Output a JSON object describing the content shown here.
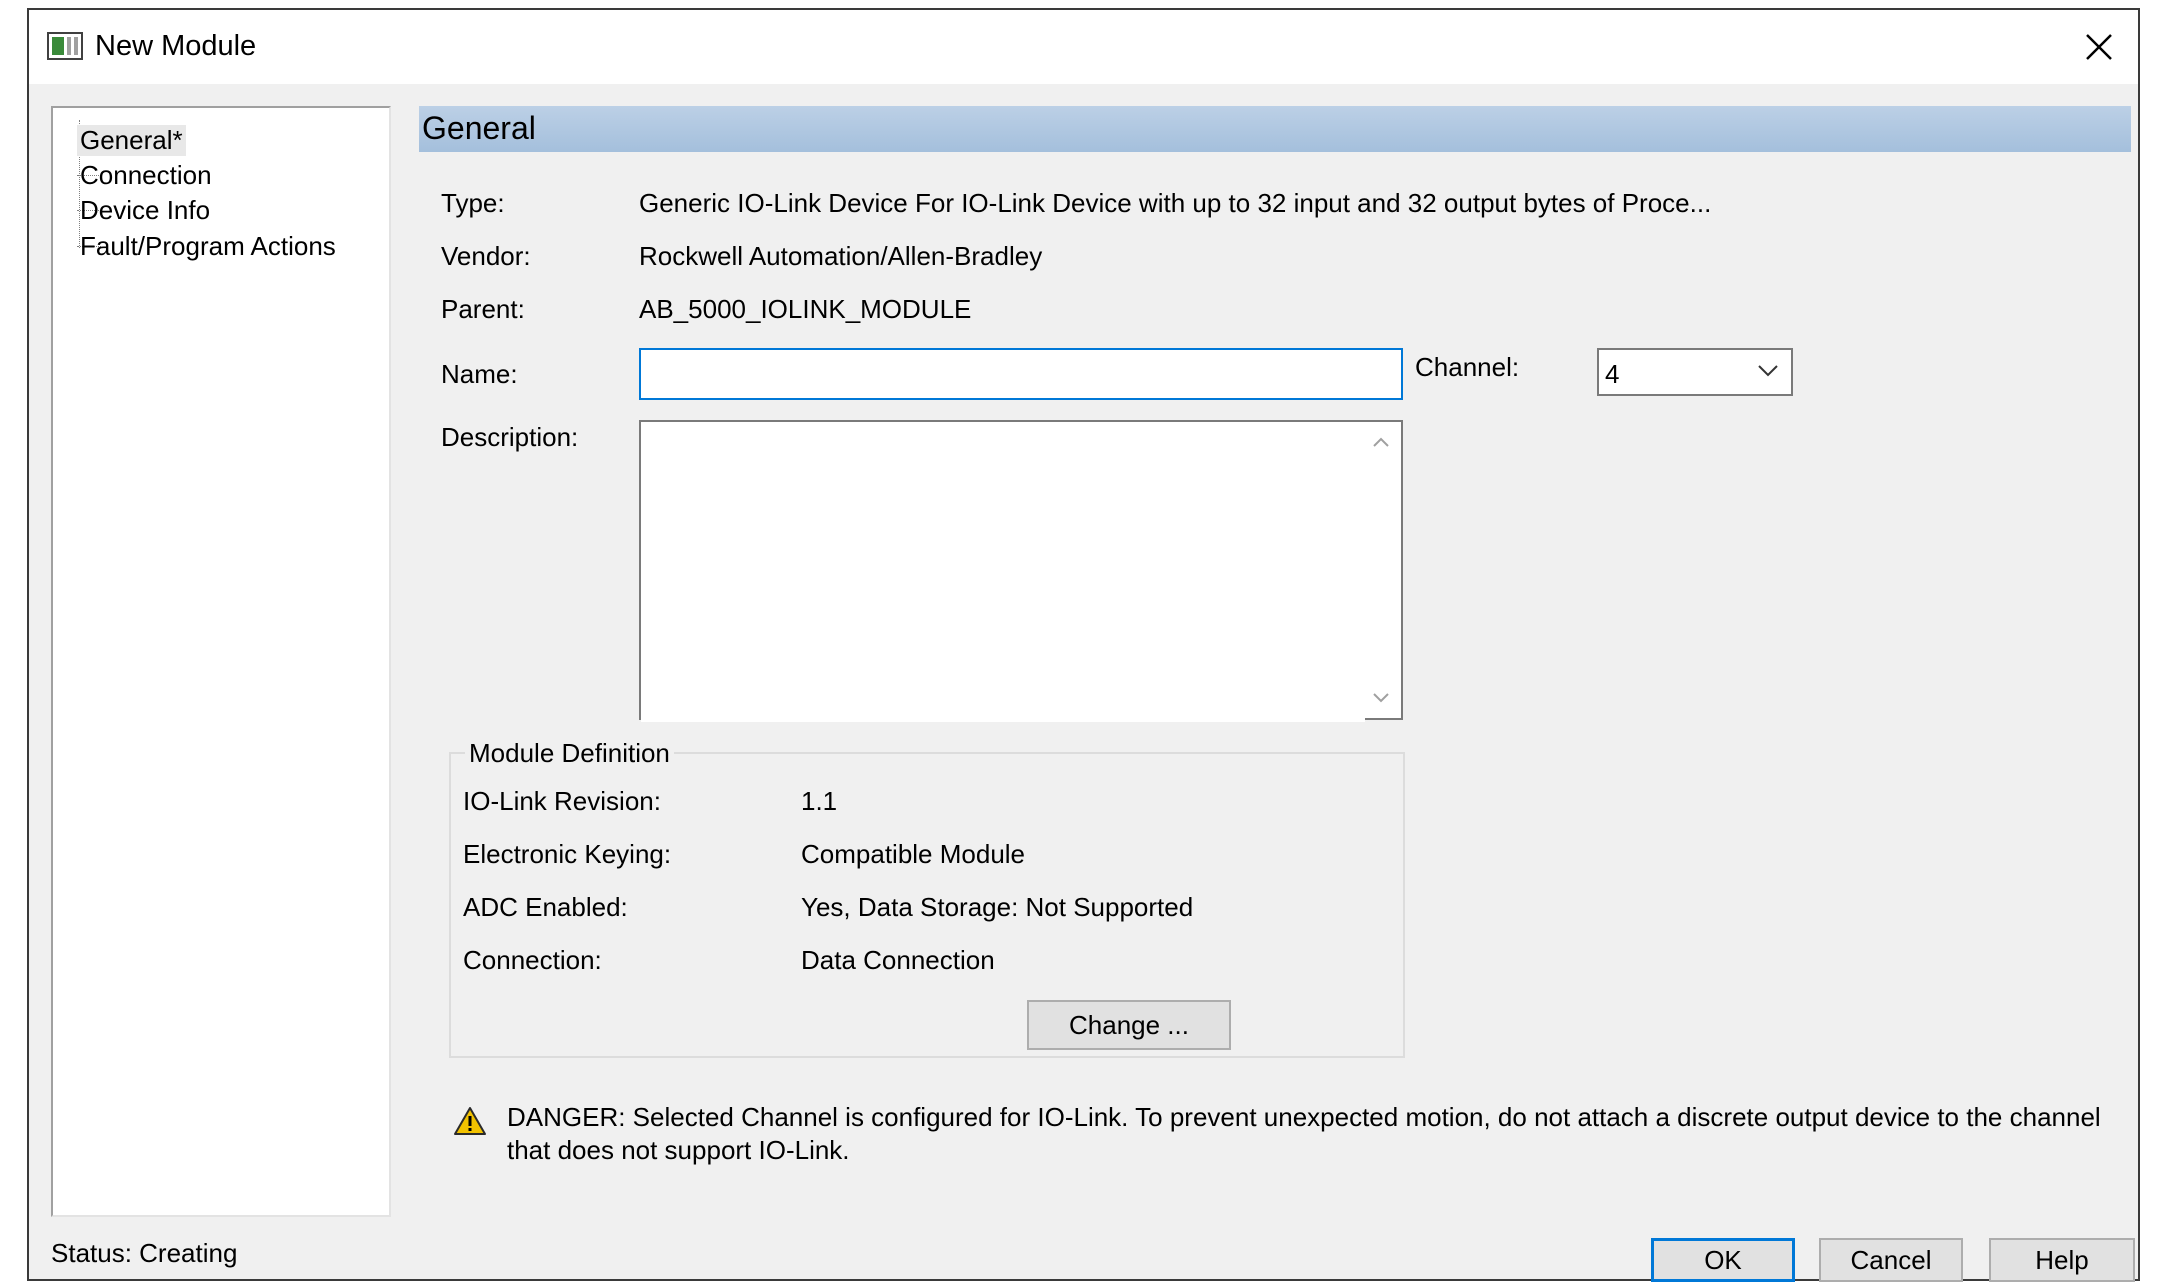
{
  "window": {
    "title": "New Module",
    "icon": "module-window-icon",
    "close_icon": "close-icon"
  },
  "nav": {
    "items": [
      {
        "label": "General*",
        "selected": true
      },
      {
        "label": "Connection",
        "selected": false
      },
      {
        "label": "Device Info",
        "selected": false
      },
      {
        "label": "Fault/Program Actions",
        "selected": false
      }
    ]
  },
  "section": {
    "header": "General"
  },
  "general": {
    "type_label": "Type:",
    "type_value": "Generic IO-Link Device For IO-Link Device with up to 32 input and 32 output bytes of Proce...",
    "vendor_label": "Vendor:",
    "vendor_value": "Rockwell Automation/Allen-Bradley",
    "parent_label": "Parent:",
    "parent_value": "AB_5000_IOLINK_MODULE",
    "name_label": "Name:",
    "name_value": "",
    "channel_label": "Channel:",
    "channel_value": "4",
    "description_label": "Description:",
    "description_value": ""
  },
  "module_definition": {
    "title": "Module Definition",
    "rows": [
      {
        "label": "IO-Link Revision:",
        "value": "1.1"
      },
      {
        "label": "Electronic Keying:",
        "value": "Compatible Module"
      },
      {
        "label": "ADC Enabled:",
        "value": "Yes, Data Storage: Not Supported"
      },
      {
        "label": "Connection:",
        "value": "Data Connection"
      }
    ],
    "change_button": "Change ..."
  },
  "warning": {
    "icon": "warning-icon",
    "text": "DANGER: Selected Channel is configured for IO-Link. To prevent unexpected motion, do not attach a discrete output device to the channel that does not support IO-Link."
  },
  "footer": {
    "status": "Status:  Creating",
    "ok": "OK",
    "cancel": "Cancel",
    "help": "Help"
  },
  "colors": {
    "accent": "#0078d7",
    "header_bar": "#a9c2de",
    "dialog_bg": "#f0f0f0",
    "warning": "#f2c200"
  }
}
